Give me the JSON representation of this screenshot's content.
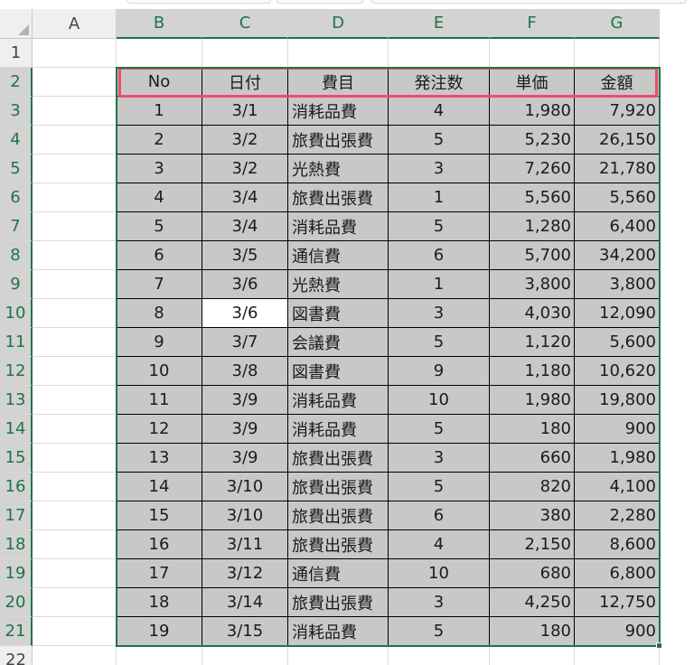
{
  "columns": [
    "A",
    "B",
    "C",
    "D",
    "E",
    "F",
    "G"
  ],
  "rows": [
    "1",
    "2",
    "3",
    "4",
    "5",
    "6",
    "7",
    "8",
    "9",
    "10",
    "11",
    "12",
    "13",
    "14",
    "15",
    "16",
    "17",
    "18",
    "19",
    "20",
    "21",
    "22"
  ],
  "header": [
    "No",
    "日付",
    "費目",
    "発注数",
    "単価",
    "金額"
  ],
  "records": [
    [
      "1",
      "3/1",
      "消耗品費",
      "4",
      "1,980",
      "7,920"
    ],
    [
      "2",
      "3/2",
      "旅費出張費",
      "5",
      "5,230",
      "26,150"
    ],
    [
      "3",
      "3/2",
      "光熱費",
      "3",
      "7,260",
      "21,780"
    ],
    [
      "4",
      "3/4",
      "旅費出張費",
      "1",
      "5,560",
      "5,560"
    ],
    [
      "5",
      "3/4",
      "消耗品費",
      "5",
      "1,280",
      "6,400"
    ],
    [
      "6",
      "3/5",
      "通信費",
      "6",
      "5,700",
      "34,200"
    ],
    [
      "7",
      "3/6",
      "光熱費",
      "1",
      "3,800",
      "3,800"
    ],
    [
      "8",
      "3/6",
      "図書費",
      "3",
      "4,030",
      "12,090"
    ],
    [
      "9",
      "3/7",
      "会議費",
      "5",
      "1,120",
      "5,600"
    ],
    [
      "10",
      "3/8",
      "図書費",
      "9",
      "1,180",
      "10,620"
    ],
    [
      "11",
      "3/9",
      "消耗品費",
      "10",
      "1,980",
      "19,800"
    ],
    [
      "12",
      "3/9",
      "消耗品費",
      "5",
      "180",
      "900"
    ],
    [
      "13",
      "3/9",
      "旅費出張費",
      "3",
      "660",
      "1,980"
    ],
    [
      "14",
      "3/10",
      "旅費出張費",
      "5",
      "820",
      "4,100"
    ],
    [
      "15",
      "3/10",
      "旅費出張費",
      "6",
      "380",
      "2,280"
    ],
    [
      "16",
      "3/11",
      "旅費出張費",
      "4",
      "2,150",
      "8,600"
    ],
    [
      "17",
      "3/12",
      "通信費",
      "10",
      "680",
      "6,800"
    ],
    [
      "18",
      "3/14",
      "旅費出張費",
      "3",
      "4,250",
      "12,750"
    ],
    [
      "19",
      "3/15",
      "消耗品費",
      "5",
      "180",
      "900"
    ]
  ],
  "selection": {
    "range": "B2:G21",
    "active_cell": "C10",
    "selected_columns": [
      "B",
      "C",
      "D",
      "E",
      "F",
      "G"
    ],
    "selected_rows": [
      "2",
      "3",
      "4",
      "5",
      "6",
      "7",
      "8",
      "9",
      "10",
      "11",
      "12",
      "13",
      "14",
      "15",
      "16",
      "17",
      "18",
      "19",
      "20",
      "21"
    ]
  },
  "colors": {
    "selection_accent": "#217346",
    "highlight_box": "#e94f6a",
    "data_fill": "#c8c8c8",
    "header_bg": "#efefef"
  }
}
